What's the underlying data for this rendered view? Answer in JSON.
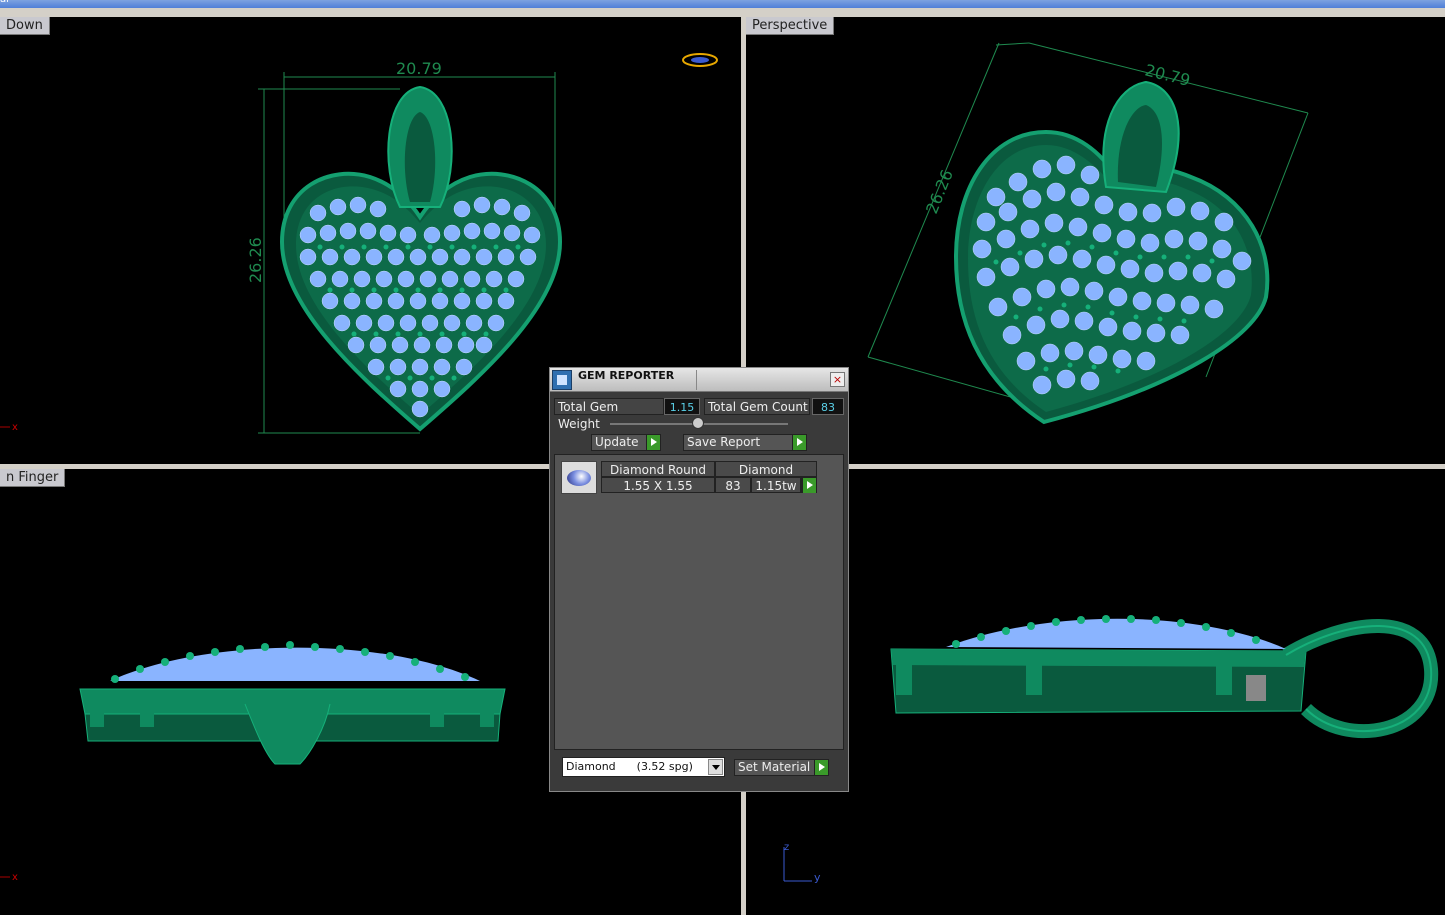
{
  "window": {
    "title_fragment": "al"
  },
  "viewports": {
    "top_left": {
      "label": "Down",
      "dim_width": "20.79",
      "dim_height": "26.26",
      "axis": "x"
    },
    "top_right": {
      "label": "Perspective",
      "dim_width": "20.79",
      "dim_height": "26.26"
    },
    "bottom_left": {
      "label": "n Finger",
      "axis": "x"
    },
    "bottom_right": {
      "axis_z": "z",
      "axis_y": "y"
    }
  },
  "gem_reporter": {
    "title": "GEM REPORTER",
    "close": "×",
    "total_weight_label": "Total Gem Weight",
    "total_weight_value": "1.15",
    "total_count_label": "Total Gem Count",
    "total_count_value": "83",
    "update_label": "Update",
    "save_report_label": "Save Report",
    "gems": [
      {
        "shape": "Diamond Round",
        "material": "Diamond",
        "size": "1.55 X 1.55",
        "count": "83",
        "weight": "1.15tw"
      }
    ],
    "material_select": "Diamond      (3.52 spg)",
    "set_material_label": "Set Material"
  },
  "colors": {
    "metal": "#0f8a5f",
    "stone": "#8ab4ff",
    "dimension": "#1f8a4f",
    "panel": "#3a3a3a"
  }
}
